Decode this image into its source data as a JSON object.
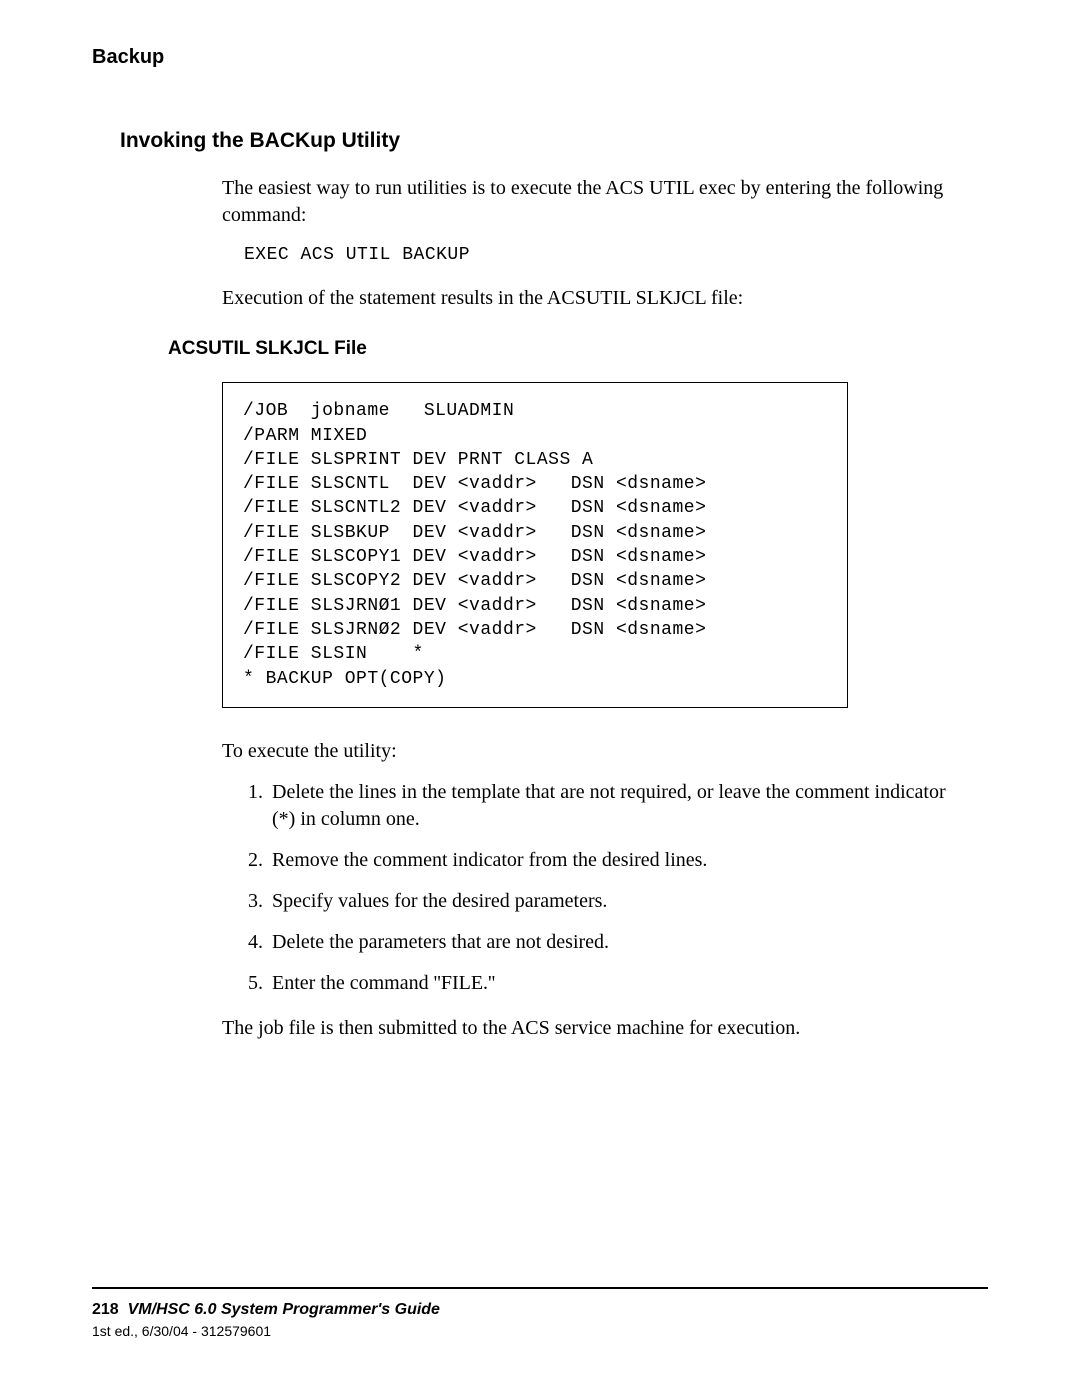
{
  "runHead": "Backup",
  "section": {
    "title": "Invoking the BACKup Utility",
    "intro": "The easiest way to run utilities is to execute the ACS UTIL exec by entering the following command:",
    "command": "EXEC ACS UTIL BACKUP",
    "afterCommand": "Execution of the statement results in the ACSUTIL SLKJCL file:",
    "subhead": "ACSUTIL SLKJCL File",
    "code": "/JOB  jobname   SLUADMIN\n/PARM MIXED\n/FILE SLSPRINT DEV PRNT CLASS A\n/FILE SLSCNTL  DEV <vaddr>   DSN <dsname>\n/FILE SLSCNTL2 DEV <vaddr>   DSN <dsname>\n/FILE SLSBKUP  DEV <vaddr>   DSN <dsname>\n/FILE SLSCOPY1 DEV <vaddr>   DSN <dsname>\n/FILE SLSCOPY2 DEV <vaddr>   DSN <dsname>\n/FILE SLSJRNØ1 DEV <vaddr>   DSN <dsname>\n/FILE SLSJRNØ2 DEV <vaddr>   DSN <dsname>\n/FILE SLSIN    *\n* BACKUP OPT(COPY)",
    "execLead": "To execute the utility:",
    "steps": [
      "Delete the lines in the template that are not required, or leave the comment indicator (*) in column one.",
      "Remove the comment indicator from the desired lines.",
      "Specify values for the desired parameters.",
      "Delete the parameters that are not desired.",
      "Enter the command ''FILE.''"
    ],
    "closing": "The job file is then submitted to the ACS service machine for execution."
  },
  "footer": {
    "pageNum": "218",
    "bookTitle": "VM/HSC 6.0 System Programmer's Guide",
    "edition": "1st ed., 6/30/04 - 312579601"
  }
}
